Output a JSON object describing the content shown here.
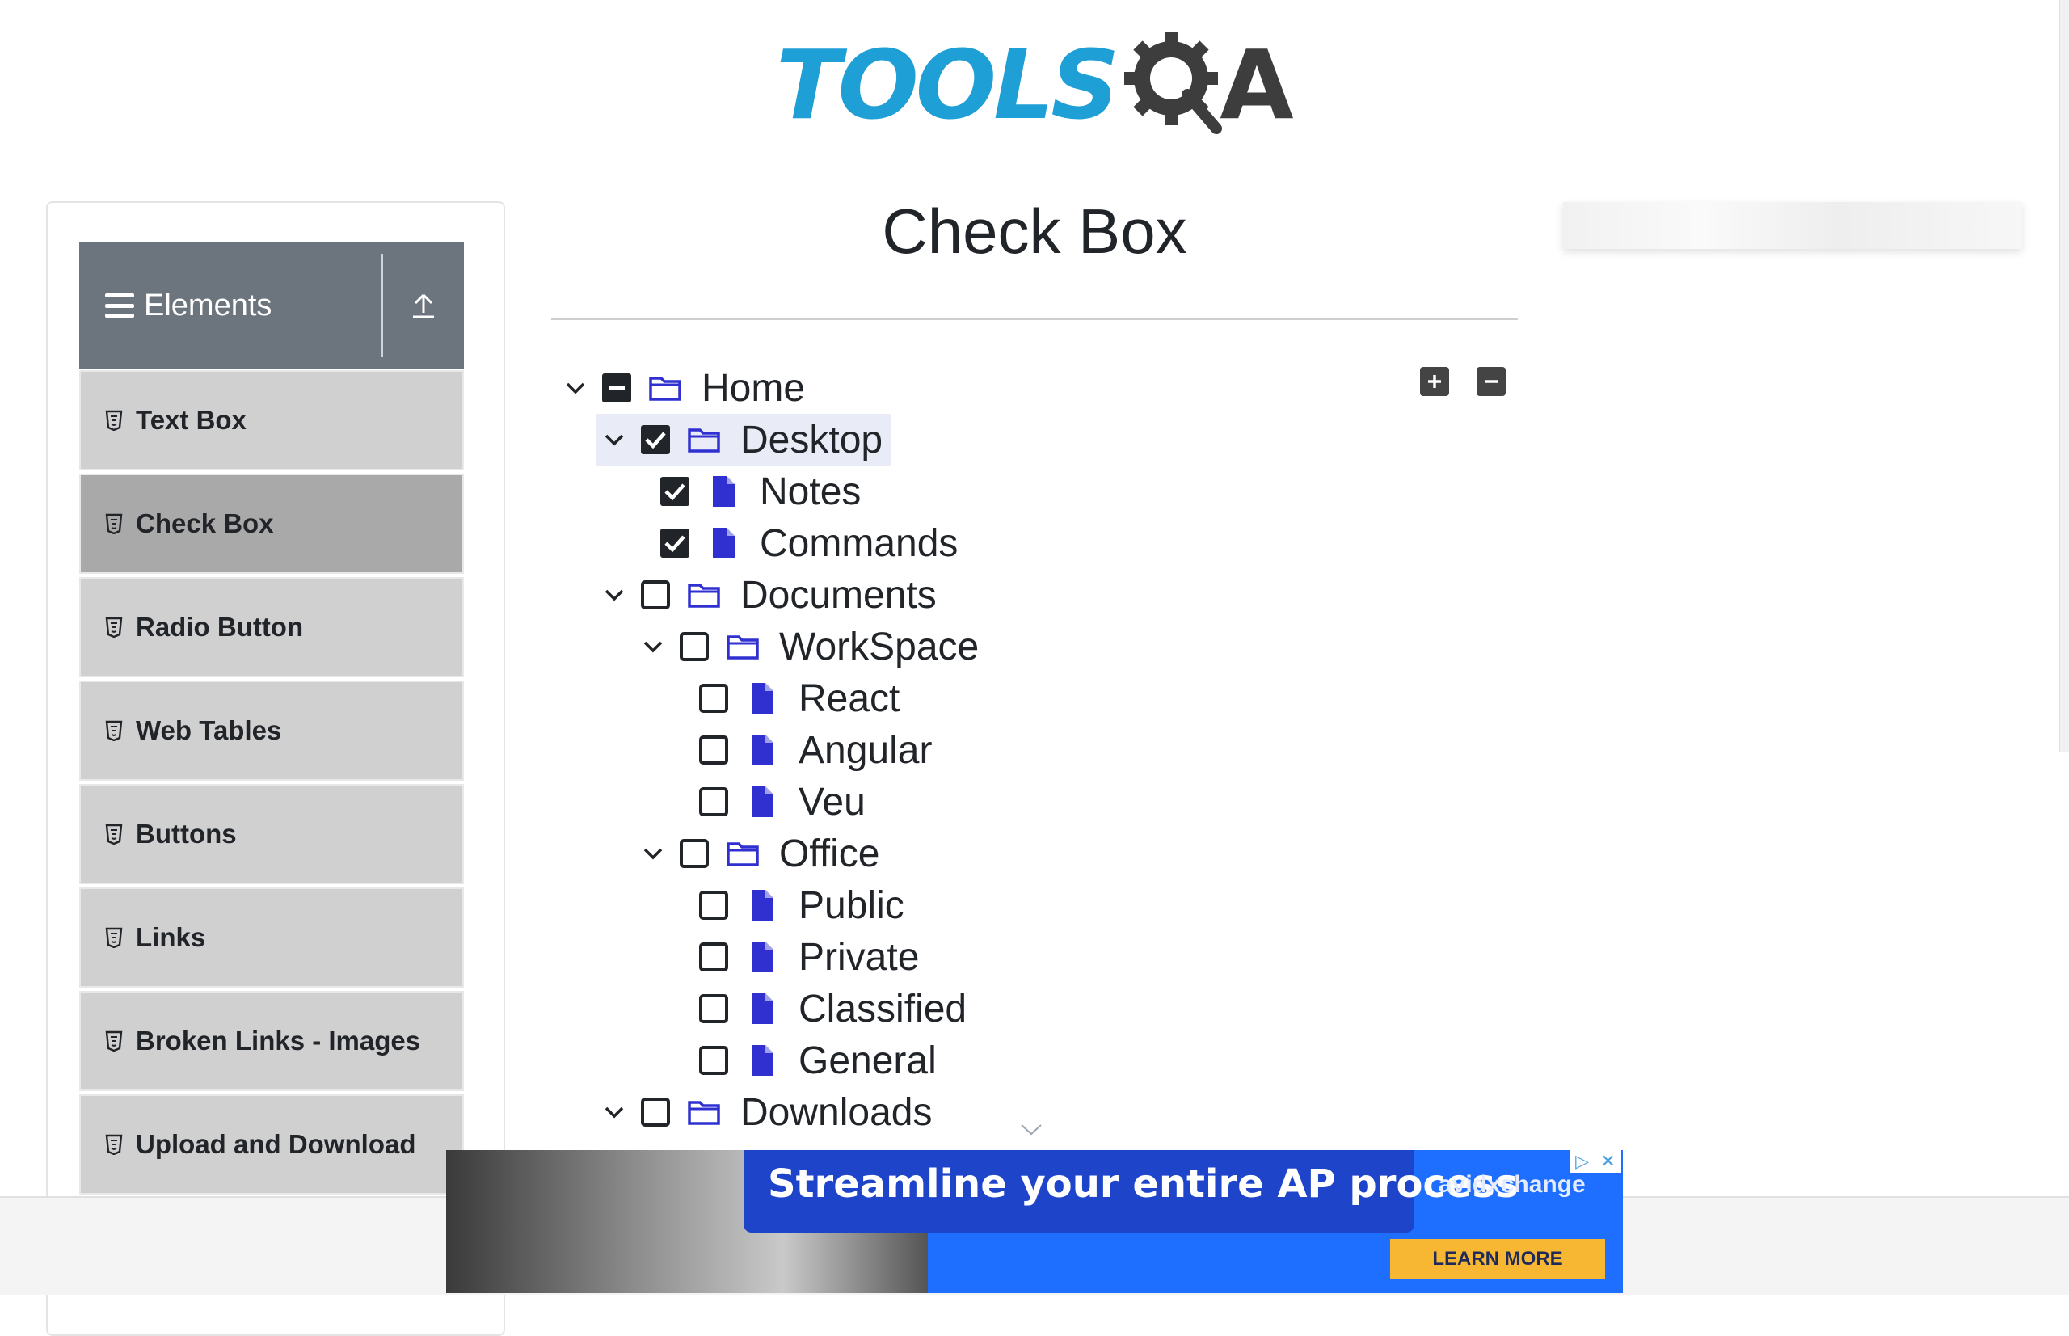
{
  "header": {
    "logo_text": "TOOLS",
    "logo_suffix": "A",
    "colors": {
      "tools": "#1e9fd6",
      "qa": "#3d3d3d"
    }
  },
  "sidebar": {
    "group_title": "Elements",
    "group_icon": "hamburger-icon",
    "collapse_icon": "upload-arrow-icon",
    "items": [
      {
        "label": "Text Box",
        "active": false
      },
      {
        "label": "Check Box",
        "active": true
      },
      {
        "label": "Radio Button",
        "active": false
      },
      {
        "label": "Web Tables",
        "active": false
      },
      {
        "label": "Buttons",
        "active": false
      },
      {
        "label": "Links",
        "active": false
      },
      {
        "label": "Broken Links - Images",
        "active": false
      },
      {
        "label": "Upload and Download",
        "active": false
      }
    ]
  },
  "main": {
    "title": "Check Box",
    "expand_all_icon": "plus-square-icon",
    "collapse_all_icon": "minus-square-icon",
    "tree": [
      {
        "label": "Home",
        "state": "partial",
        "type": "folder",
        "expanded": true
      },
      {
        "label": "Desktop",
        "state": "checked",
        "type": "folder",
        "expanded": true
      },
      {
        "label": "Notes",
        "state": "checked",
        "type": "file"
      },
      {
        "label": "Commands",
        "state": "checked",
        "type": "file"
      },
      {
        "label": "Documents",
        "state": "unchecked",
        "type": "folder",
        "expanded": true
      },
      {
        "label": "WorkSpace",
        "state": "unchecked",
        "type": "folder",
        "expanded": true
      },
      {
        "label": "React",
        "state": "unchecked",
        "type": "file"
      },
      {
        "label": "Angular",
        "state": "unchecked",
        "type": "file"
      },
      {
        "label": "Veu",
        "state": "unchecked",
        "type": "file"
      },
      {
        "label": "Office",
        "state": "unchecked",
        "type": "folder",
        "expanded": true
      },
      {
        "label": "Public",
        "state": "unchecked",
        "type": "file"
      },
      {
        "label": "Private",
        "state": "unchecked",
        "type": "file"
      },
      {
        "label": "Classified",
        "state": "unchecked",
        "type": "file"
      },
      {
        "label": "General",
        "state": "unchecked",
        "type": "file"
      },
      {
        "label": "Downloads",
        "state": "unchecked",
        "type": "folder",
        "expanded": true
      }
    ],
    "accent_color": "#3030d0"
  },
  "ad": {
    "headline": "Streamline your entire AP process",
    "brand": "avidxchange",
    "cta": "LEARN MORE"
  }
}
